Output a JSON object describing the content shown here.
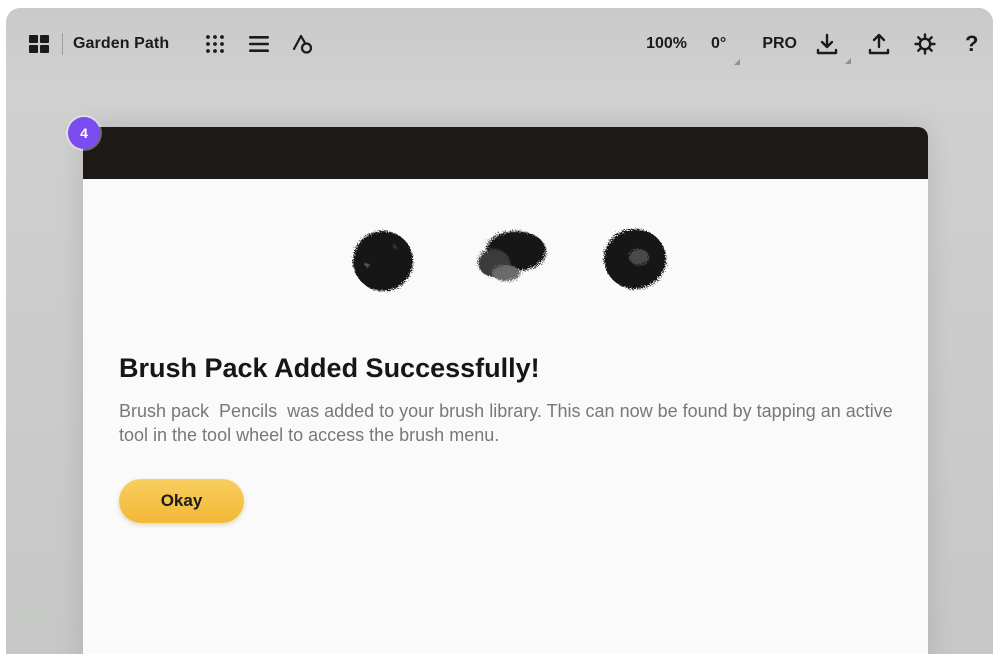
{
  "toolbar": {
    "document_title": "Garden Path",
    "zoom": "100%",
    "rotation": "0°",
    "pro_label": "PRO",
    "help_label": "?",
    "icons": {
      "gallery": "gallery-grid-icon",
      "tool_grid": "dot-grid-icon",
      "menu": "hamburger-menu-icon",
      "shapes": "shapes-icon",
      "export": "export-download-icon",
      "share": "share-upload-icon",
      "settings": "settings-icon"
    }
  },
  "step_badge": "4",
  "dialog": {
    "title": "Brush Pack Added Successfully!",
    "message": "Brush pack  Pencils  was added to your brush library. This can now be found by tapping an active tool in the tool wheel to access the brush menu.",
    "okay_label": "Okay",
    "header_color": "#1c1917",
    "accent_color": "#f4bf46",
    "badge_color": "#7b4cf0"
  }
}
